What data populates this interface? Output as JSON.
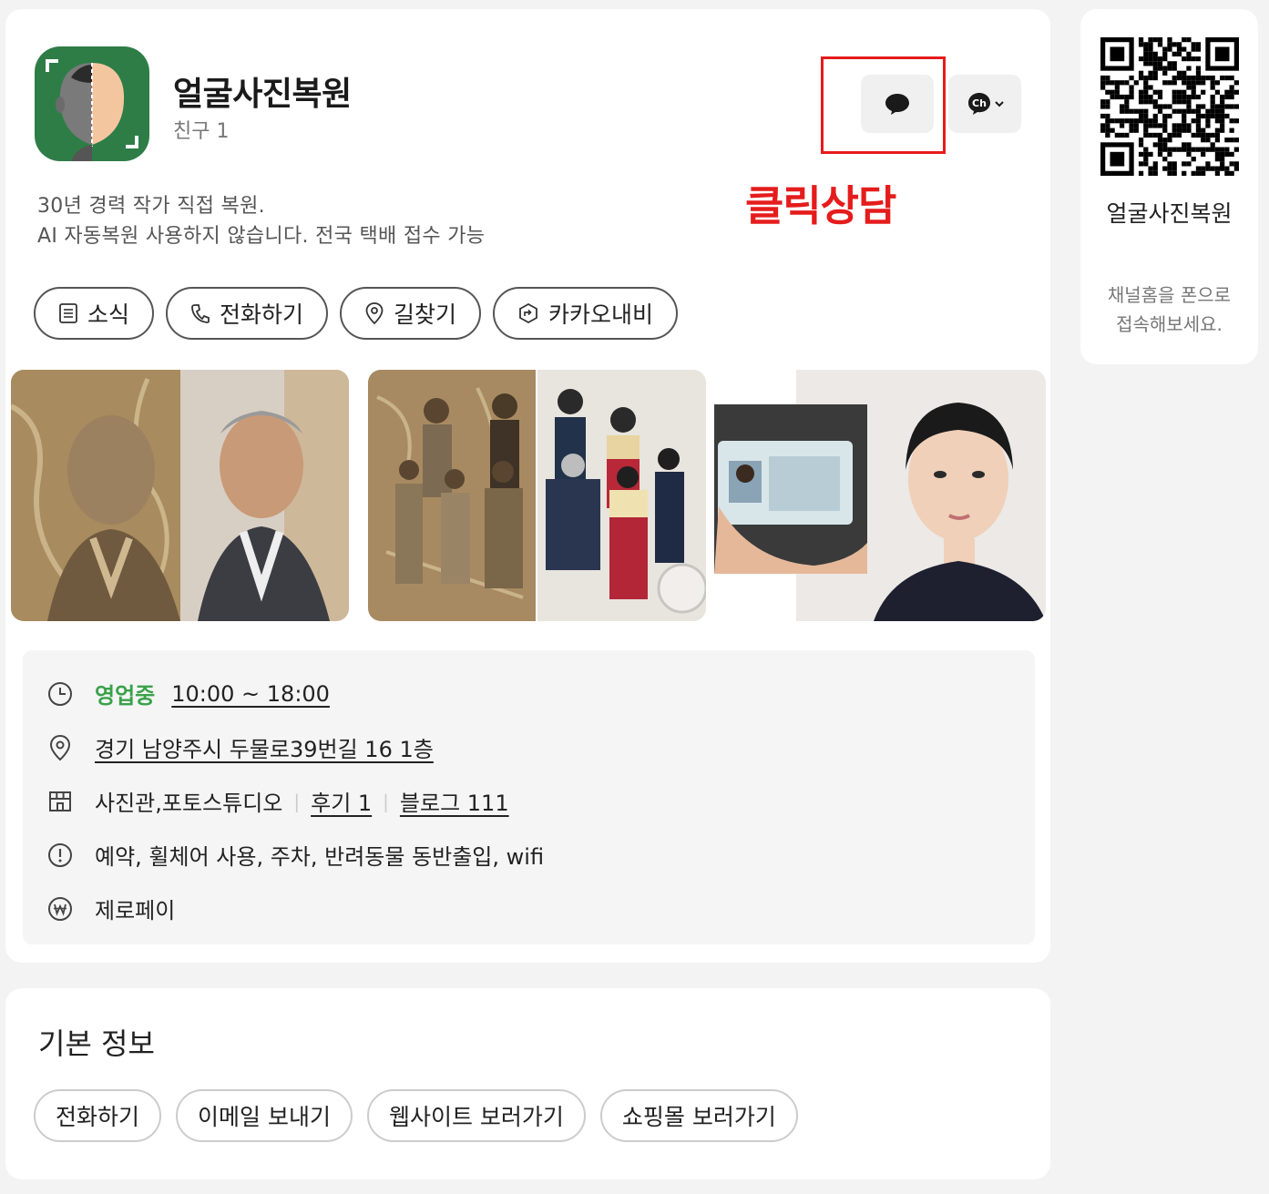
{
  "profile": {
    "name": "얼굴사진복원",
    "friends": "친구 1",
    "desc_line1": "30년 경력 작가 직접 복원.",
    "desc_line2": "AI 자동복원 사용하지 않습니다. 전국 택배 접수 가능",
    "annotation": "클릭상담",
    "annotation_color": "#e51c1c",
    "brand_color": "#2e7d47"
  },
  "actions": [
    {
      "label": "소식",
      "icon": "document-icon"
    },
    {
      "label": "전화하기",
      "icon": "phone-icon"
    },
    {
      "label": "길찾기",
      "icon": "location-pin-icon"
    },
    {
      "label": "카카오내비",
      "icon": "navi-icon"
    }
  ],
  "details": {
    "status": "영업중",
    "status_color": "#3aa14a",
    "hours": "10:00 ~ 18:00",
    "address": "경기 남양주시 두물로39번길 16 1층",
    "category": "사진관,포토스튜디오",
    "reviews": "후기 1",
    "blog": "블로그 111",
    "amenities": "예약, 휠체어 사용, 주차, 반려동물 동반출입, wifi",
    "payment": "제로페이"
  },
  "basic_info": {
    "title": "기본 정보",
    "buttons": [
      "전화하기",
      "이메일 보내기",
      "웹사이트 보러가기",
      "쇼핑몰 보러가기"
    ]
  },
  "qr_panel": {
    "name": "얼굴사진복원",
    "subtitle_line1": "채널홈을 폰으로",
    "subtitle_line2": "접속해보세요."
  }
}
